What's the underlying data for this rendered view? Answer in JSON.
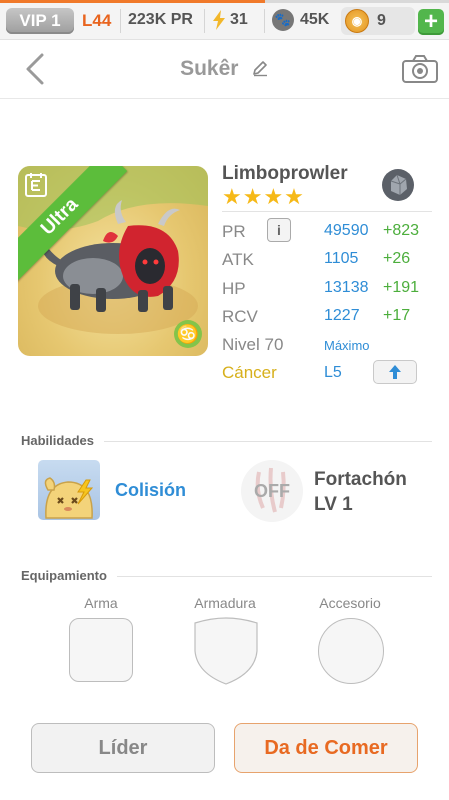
{
  "status": {
    "progress": 0.59,
    "vip": "VIP 1",
    "level": "L44",
    "pr": "223K PR",
    "energy": "31",
    "food": "45K",
    "coins": "9",
    "add": "+"
  },
  "header": {
    "title": "Sukêr"
  },
  "pet": {
    "name": "Limboprowler",
    "rarity": "Ultra",
    "stars": "★★★★",
    "star_count": 4,
    "zodiac_symbol": "♋",
    "stats": {
      "pr_label": "PR",
      "pr_info": "i",
      "pr_value": "49590",
      "pr_bonus": "+823",
      "atk_label": "ATK",
      "atk_value": "1105",
      "atk_bonus": "+26",
      "hp_label": "HP",
      "hp_value": "13138",
      "hp_bonus": "+191",
      "rcv_label": "RCV",
      "rcv_value": "1227",
      "rcv_bonus": "+17",
      "level_label": "Nivel 70",
      "level_value": "Máximo",
      "zodiac_label": "Cáncer",
      "zodiac_level": "L5"
    }
  },
  "skills": {
    "title": "Habilidades",
    "skill1": "Colisión",
    "skill2_state": "OFF",
    "skill2_name": "Fortachón",
    "skill2_level": "LV 1"
  },
  "equipment": {
    "title": "Equipamiento",
    "weapon": "Arma",
    "armor": "Armadura",
    "accessory": "Accesorio"
  },
  "buttons": {
    "leader": "Líder",
    "feed": "Da de Comer"
  },
  "colors": {
    "accent_orange": "#e86a22",
    "blue": "#2f8dd6",
    "green": "#4cae3c",
    "ultra_green": "#5cbd3b"
  }
}
